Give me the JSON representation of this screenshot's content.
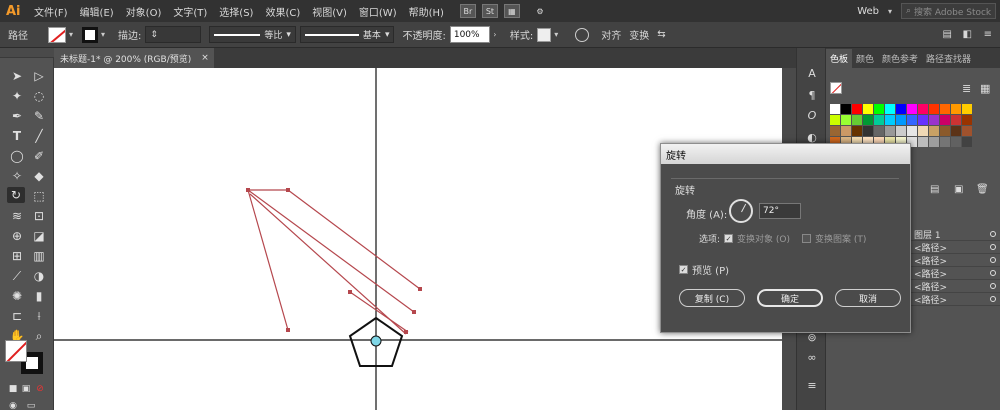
{
  "app": {
    "logo": "Ai",
    "menus": [
      "文件(F)",
      "编辑(E)",
      "对象(O)",
      "文字(T)",
      "选择(S)",
      "效果(C)",
      "视图(V)",
      "窗口(W)",
      "帮助(H)"
    ],
    "bridge": "Br",
    "stock": "St",
    "workspace": "Web",
    "search_placeholder": "搜索 Adobe Stock"
  },
  "control": {
    "path_label": "路径",
    "stroke_label": "描边:",
    "stroke_profile": "等比",
    "brush": "基本",
    "opacity_label": "不透明度:",
    "opacity_value": "100%",
    "style_label": "样式:",
    "align_label": "对齐",
    "transform_label": "变换"
  },
  "document": {
    "tab_title": "未标题-1* @ 200% (RGB/预览)",
    "close_glyph": "×"
  },
  "panel": {
    "tabs": [
      "色板",
      "颜色",
      "颜色参考",
      "路径查找器"
    ],
    "active_tab": "色板",
    "layers": [
      {
        "name": "图层 1"
      },
      {
        "name": "<路径>"
      },
      {
        "name": "<路径>"
      },
      {
        "name": "<路径>"
      },
      {
        "name": "<路径>"
      },
      {
        "name": "<路径>"
      }
    ],
    "swatches": [
      "#ffffff",
      "#000000",
      "#ff0000",
      "#ffff00",
      "#00ff00",
      "#00ffff",
      "#0000ff",
      "#ff00ff",
      "#ff0066",
      "#ff3300",
      "#ff6600",
      "#ff9900",
      "#ffcc00",
      "#ccff00",
      "#99ff33",
      "#66cc33",
      "#009933",
      "#00cc99",
      "#00ccff",
      "#0099ff",
      "#3366ff",
      "#6633ff",
      "#9933cc",
      "#cc0066",
      "#cc3333",
      "#993300",
      "#996633",
      "#cc9966",
      "#663300",
      "#333333",
      "#666666",
      "#999999",
      "#cccccc",
      "#e6e6e6",
      "#f0d9b5",
      "#c8a165",
      "#8b5a2b",
      "#5c3317",
      "#a0522d",
      "#d2691e",
      "#deb887",
      "#f5deb3",
      "#ffe4c4",
      "#ffdab9",
      "#eee8aa",
      "#fafad2",
      "#e0e0e0",
      "#bdbdbd",
      "#9e9e9e",
      "#757575",
      "#616161",
      "#424242"
    ]
  },
  "dialog": {
    "title": "旋转",
    "group_title": "旋转",
    "angle_label": "角度 (A):",
    "angle_value": "72°",
    "options_label": "选项:",
    "transform_objects": "变换对象 (O)",
    "transform_patterns": "变换图案 (T)",
    "preview_label": "预览 (P)",
    "copy_button": "复制 (C)",
    "ok_button": "确定",
    "cancel_button": "取消",
    "preview_checked": true,
    "transform_objects_checked": true,
    "transform_patterns_checked": false
  },
  "colors": {
    "accent_path": "#b5474d",
    "dialog_bg": "#4b4b4b",
    "ui_dark": "#323232"
  }
}
